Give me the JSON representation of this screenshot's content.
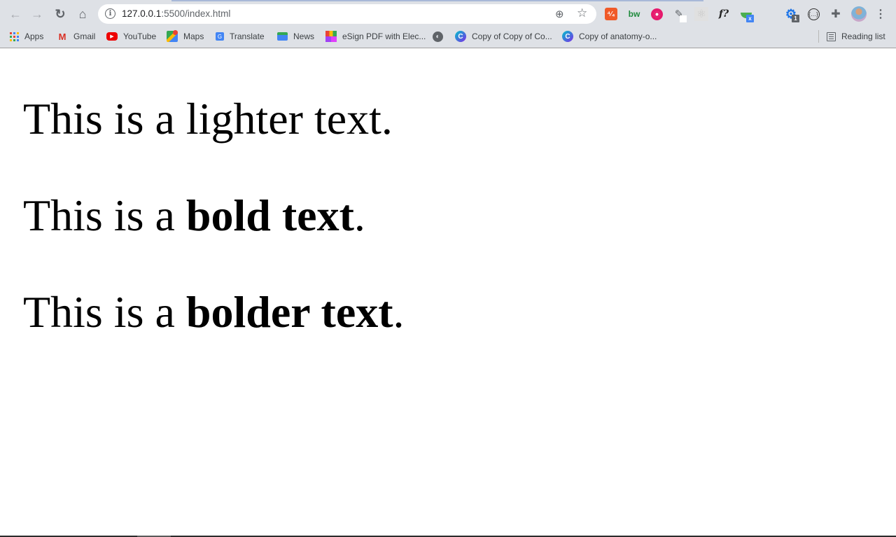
{
  "browser": {
    "address_bar": {
      "host": "127.0.0.1",
      "port_path": ":5500/index.html"
    },
    "nav": {
      "back_icon": "arrow-left-icon",
      "forward_icon": "arrow-right-icon",
      "reload_icon": "reload-icon",
      "home_icon": "home-icon"
    },
    "extensions": [
      {
        "name": "text-extension",
        "glyph": "⁴⁄₄"
      },
      {
        "name": "bw-extension",
        "glyph": "bw"
      },
      {
        "name": "eye-extension",
        "glyph": ""
      },
      {
        "name": "eyedropper-extension",
        "glyph": "✎"
      },
      {
        "name": "react-devtools-extension",
        "glyph": "⚛"
      },
      {
        "name": "whatfont-extension",
        "glyph": "f?"
      },
      {
        "name": "excel-extension",
        "glyph": "x"
      },
      {
        "name": "colorpicker-extension",
        "glyph": ""
      },
      {
        "name": "settings-extension",
        "glyph": "⚙",
        "badge": "1"
      },
      {
        "name": "devtools-extension",
        "glyph": "{…}"
      },
      {
        "name": "extensions-puzzle",
        "glyph": "✚"
      }
    ],
    "bookmarks": [
      {
        "label": "Apps",
        "icon": "apps-grid-icon"
      },
      {
        "label": "Gmail",
        "icon": "gmail-icon"
      },
      {
        "label": "YouTube",
        "icon": "youtube-icon"
      },
      {
        "label": "Maps",
        "icon": "maps-icon"
      },
      {
        "label": "Translate",
        "icon": "translate-icon"
      },
      {
        "label": "News",
        "icon": "news-icon"
      },
      {
        "label": "eSign PDF with Elec...",
        "icon": "esign-icon"
      },
      {
        "label": "",
        "icon": "globe-icon"
      },
      {
        "label": "Copy of Copy of Co...",
        "icon": "canva-icon"
      },
      {
        "label": "Copy of anatomy-o...",
        "icon": "canva-icon"
      }
    ],
    "reading_list": "Reading list"
  },
  "page": {
    "lines": [
      {
        "prefix": "This is a ",
        "emphasis": "lighter text",
        "suffix": "."
      },
      {
        "prefix": "This is a ",
        "emphasis": "bold text",
        "suffix": "."
      },
      {
        "prefix": "This is a ",
        "emphasis": "bolder text",
        "suffix": "."
      }
    ]
  }
}
